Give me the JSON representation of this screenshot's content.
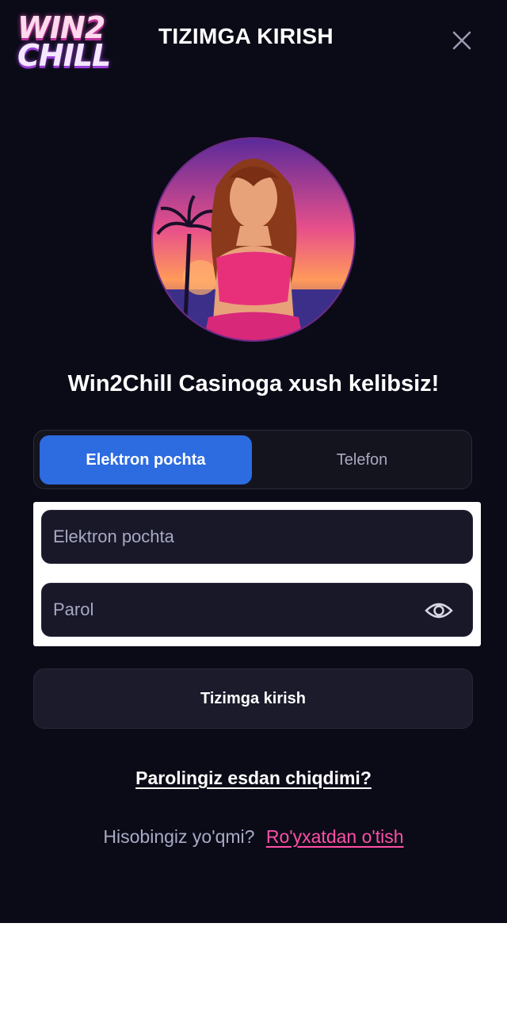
{
  "header": {
    "logo_line1": "WIN2",
    "logo_line2": "CHILL",
    "title": "TIZIMGA KIRISH"
  },
  "welcome": "Win2Chill Casinoga xush kelibsiz!",
  "tabs": [
    {
      "label": "Elektron pochta",
      "active": true
    },
    {
      "label": "Telefon",
      "active": false
    }
  ],
  "form": {
    "email_placeholder": "Elektron pochta",
    "email_value": "",
    "password_placeholder": "Parol",
    "password_value": ""
  },
  "login_button": "Tizimga kirish",
  "forgot_link": "Parolingiz esdan chiqdimi?",
  "register": {
    "question": "Hisobingiz yo'qmi?",
    "link": "Ro'yxatdan o'tish"
  },
  "colors": {
    "background": "#0b0b18",
    "accent_blue": "#2d6be0",
    "link_pink": "#ff4fa6"
  },
  "icons": {
    "close": "close-icon",
    "password_toggle": "eye-icon"
  }
}
